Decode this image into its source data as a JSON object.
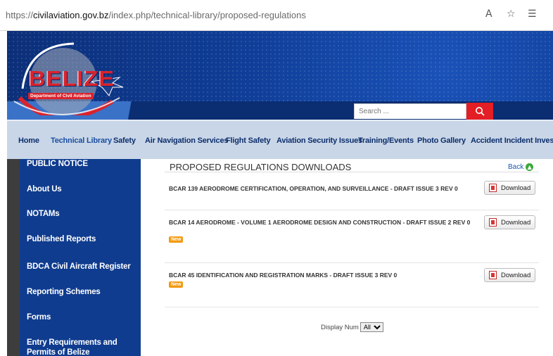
{
  "browser": {
    "url_prefix": "https://",
    "url_host": "civilaviation.gov.bz",
    "url_path": "/index.php/technical-library/proposed-regulations",
    "icons": [
      "read-aloud-icon",
      "add-favorite-icon",
      "favorites-icon"
    ]
  },
  "banner": {
    "logo_title": "BELIZE",
    "logo_subtitle": "Department of Civil Aviation",
    "search_placeholder": "Search ..."
  },
  "topnav": {
    "items": [
      {
        "label": "Home"
      },
      {
        "label": "Technical Library",
        "active": true
      },
      {
        "label": "Safety"
      },
      {
        "label": "Air Navigation Services"
      },
      {
        "label": "Flight Safety"
      },
      {
        "label": "Aviation Security Issues"
      },
      {
        "label": "Training/Events"
      },
      {
        "label": "Photo Gallery"
      },
      {
        "label": "Accident Incident Investigatio"
      }
    ]
  },
  "sidebar": {
    "items": [
      {
        "label": "PUBLIC NOTICE"
      },
      {
        "label": "About Us"
      },
      {
        "label": "NOTAMs"
      },
      {
        "label": "Published Reports"
      },
      {
        "label": "BDCA Civil Aircraft Register"
      },
      {
        "label": "Reporting Schemes"
      },
      {
        "label": "Forms"
      },
      {
        "label": "Entry Requirements and Permits of Belize"
      }
    ]
  },
  "main": {
    "heading": "PROPOSED REGULATIONS DOWNLOADS",
    "back_label": "Back",
    "download_label": "Download",
    "new_label": "New",
    "documents": [
      {
        "title": "BCAR 139 AERODROME CERTIFICATION, OPERATION, AND SURVEILLANCE - DRAFT ISSUE 3 REV 0",
        "is_new": false
      },
      {
        "title": "BCAR 14 AERODROME - VOLUME 1 AERODROME DESIGN AND CONSTRUCTION - DRAFT ISSUE 2 REV 0",
        "is_new": true
      },
      {
        "title": "BCAR 45 IDENTIFICATION AND REGISTRATION MARKS - DRAFT ISSUE 3 REV 0",
        "is_new": true
      }
    ],
    "display_num_label": "Display Num",
    "display_num_value": "All"
  },
  "colors": {
    "banner_blue": "#0f3e98",
    "sidebar_blue": "#0f3c8f",
    "nav_bg": "#c9d6e8",
    "search_red": "#e31e24",
    "badge_orange": "#f39a11"
  }
}
